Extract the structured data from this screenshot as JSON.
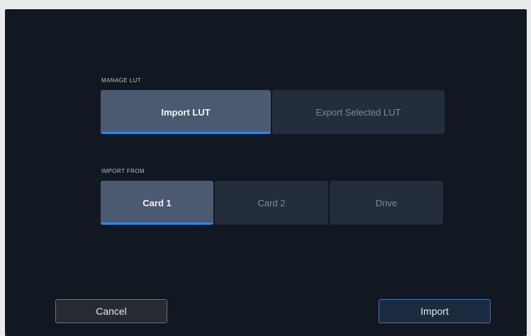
{
  "manage_lut": {
    "label": "MANAGE LUT",
    "options": [
      {
        "label": "Import LUT",
        "selected": true
      },
      {
        "label": "Export Selected LUT",
        "selected": false
      }
    ]
  },
  "import_from": {
    "label": "IMPORT FROM",
    "options": [
      {
        "label": "Card 1",
        "selected": true
      },
      {
        "label": "Card 2",
        "selected": false
      },
      {
        "label": "Drive",
        "selected": false
      }
    ]
  },
  "footer": {
    "cancel_label": "Cancel",
    "import_label": "Import"
  },
  "colors": {
    "background": "#121821",
    "segment": "#232d3b",
    "segment_active": "#4b5a70",
    "accent": "#2f86e6"
  }
}
